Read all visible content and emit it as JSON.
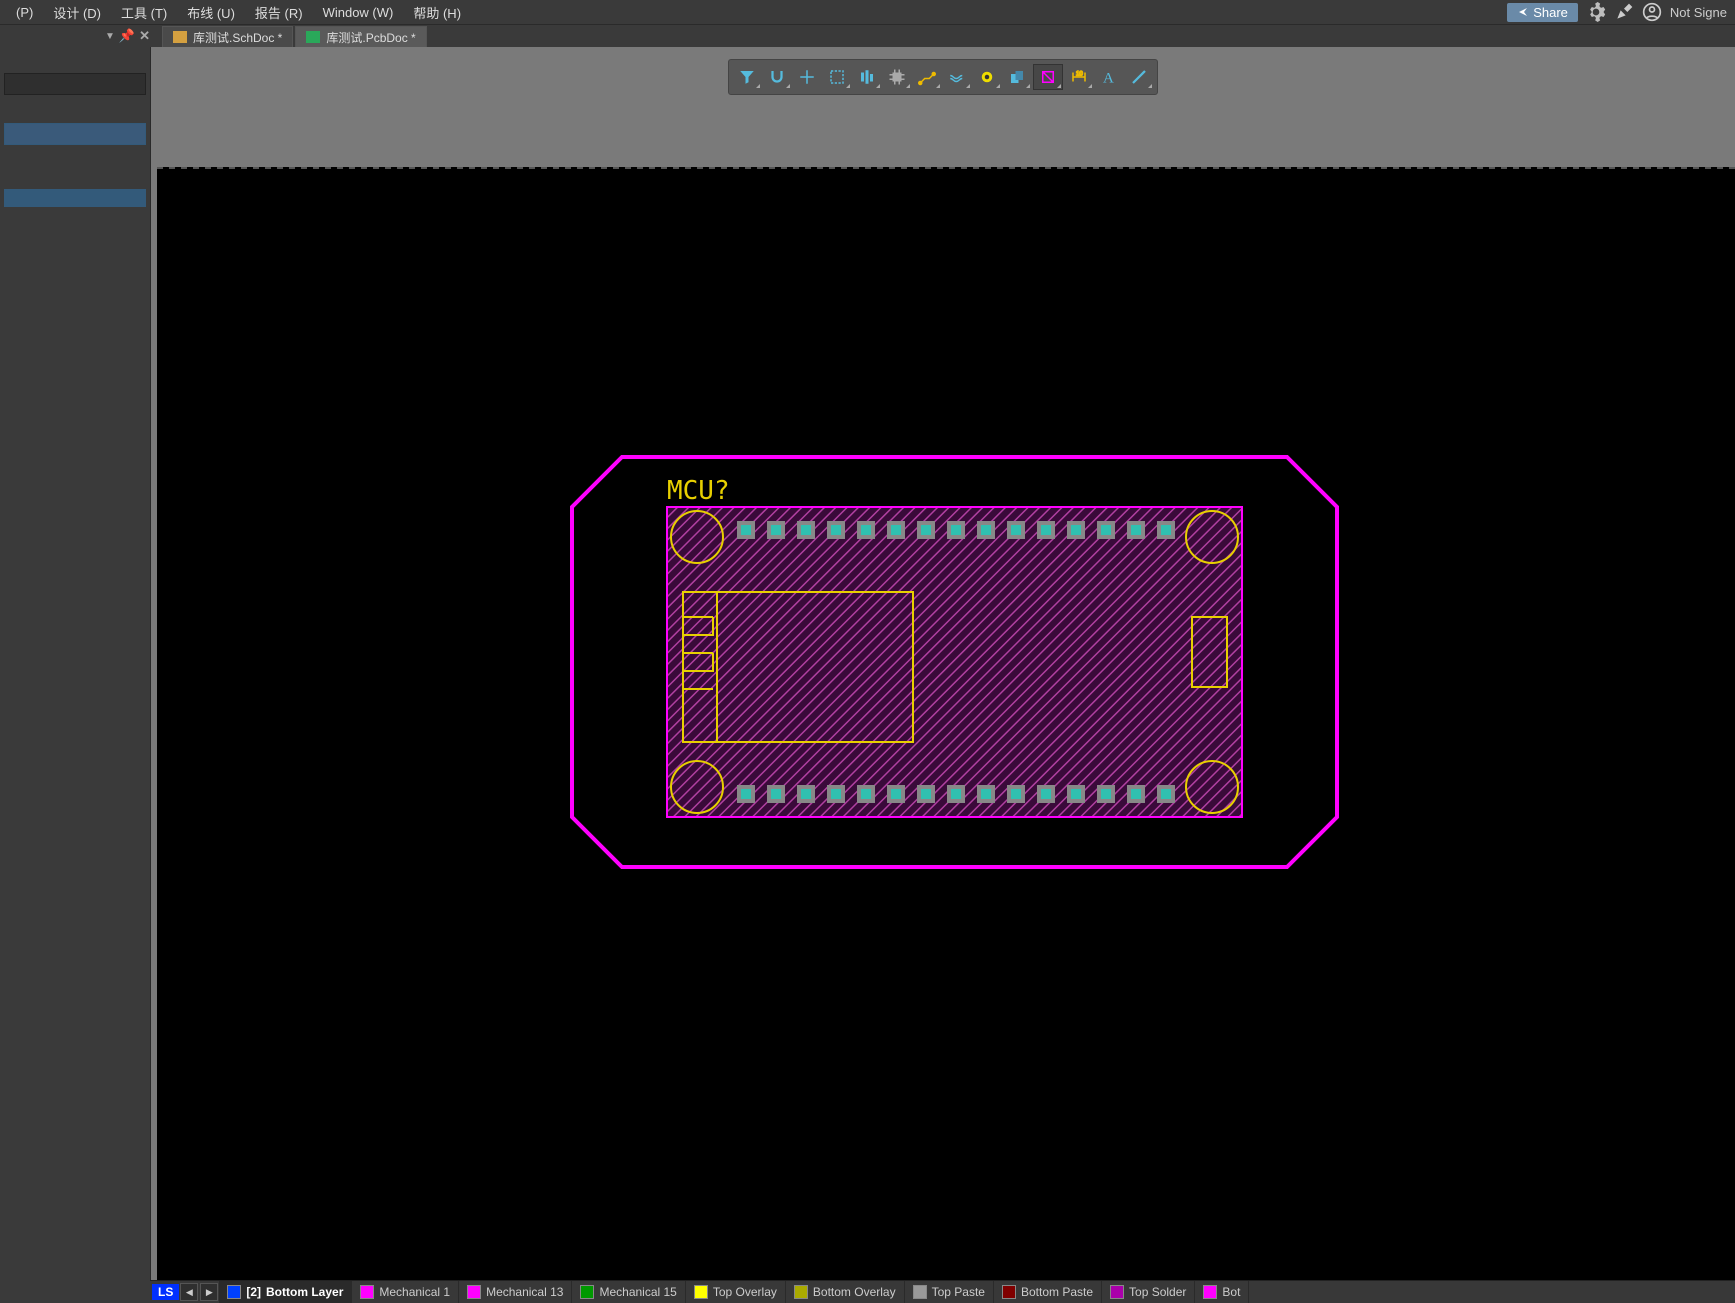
{
  "menu": {
    "items": [
      "(P)",
      "设计 (D)",
      "工具 (T)",
      "布线 (U)",
      "报告 (R)",
      "Window (W)",
      "帮助 (H)"
    ]
  },
  "topright": {
    "share": "Share",
    "notsigned": "Not Signe"
  },
  "tabs": [
    {
      "label": "库测试.SchDoc *",
      "kind": "sch",
      "active": false
    },
    {
      "label": "库测试.PcbDoc *",
      "kind": "pcb",
      "active": true
    }
  ],
  "designator": "MCU?",
  "layers": {
    "ls": "LS",
    "current": {
      "num": "[2]",
      "name": "Bottom Layer"
    },
    "items": [
      {
        "name": "Mechanical 1",
        "color": "#ff00ff"
      },
      {
        "name": "Mechanical 13",
        "color": "#ff00ff"
      },
      {
        "name": "Mechanical 15",
        "color": "#009900"
      },
      {
        "name": "Top Overlay",
        "color": "#ffff00"
      },
      {
        "name": "Bottom Overlay",
        "color": "#aaaa00"
      },
      {
        "name": "Top Paste",
        "color": "#999999"
      },
      {
        "name": "Bottom Paste",
        "color": "#800000"
      },
      {
        "name": "Top Solder",
        "color": "#aa00aa"
      },
      {
        "name": "Bot",
        "color": "#ff00ff"
      }
    ]
  },
  "tools": [
    {
      "name": "filter-icon"
    },
    {
      "name": "magnet-icon"
    },
    {
      "name": "crosshair-icon"
    },
    {
      "name": "select-rect-icon"
    },
    {
      "name": "align-icon"
    },
    {
      "name": "component-icon"
    },
    {
      "name": "route-icon"
    },
    {
      "name": "diff-pair-icon"
    },
    {
      "name": "via-icon"
    },
    {
      "name": "polygon-icon"
    },
    {
      "name": "fill-icon",
      "selected": true
    },
    {
      "name": "dimension-icon"
    },
    {
      "name": "text-icon"
    },
    {
      "name": "line-icon"
    }
  ],
  "colors": {
    "outline": "#ff00ff",
    "copper": "#8a1a7a",
    "silk": "#e8d000",
    "pad": "#30c0b0"
  }
}
